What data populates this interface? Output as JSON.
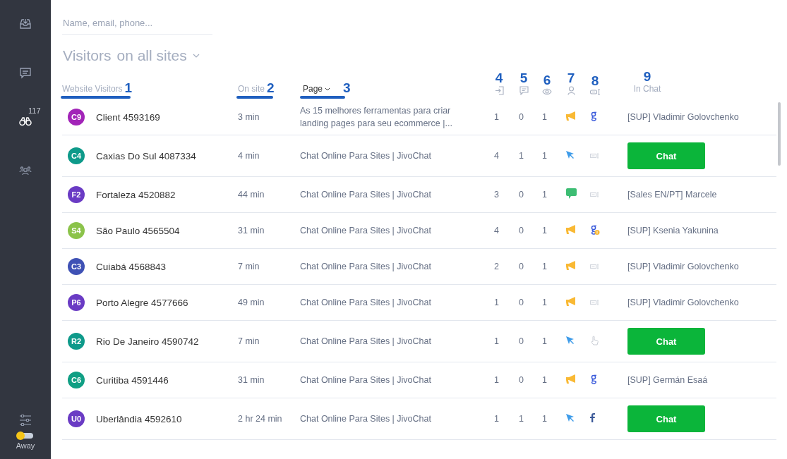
{
  "sidebar": {
    "items": [
      {
        "kind": "inbox",
        "selected": false
      },
      {
        "kind": "chats",
        "selected": false
      },
      {
        "kind": "visitors",
        "selected": true,
        "badge": "117"
      },
      {
        "kind": "team",
        "selected": false
      }
    ],
    "status": {
      "label": "Away",
      "online": false
    }
  },
  "search": {
    "placeholder": "Name, email, phone..."
  },
  "title": {
    "text": "Visitors",
    "filter": "on all sites"
  },
  "columns": [
    {
      "kind": "text",
      "label": "Website Visitors",
      "marker": "1"
    },
    {
      "kind": "text",
      "label": "On site",
      "marker": "2"
    },
    {
      "kind": "sort",
      "label": "Page",
      "marker": "3"
    },
    {
      "kind": "entries",
      "marker": "4"
    },
    {
      "kind": "messages",
      "marker": "5"
    },
    {
      "kind": "views",
      "marker": "6"
    },
    {
      "kind": "person",
      "marker": "7"
    },
    {
      "kind": "widget",
      "marker": "8"
    },
    {
      "kind": "text",
      "label": "In Chat",
      "marker": "9"
    }
  ],
  "rows": [
    {
      "initials": "C9",
      "color": "#a224b8",
      "name": "Client 4593169",
      "time": "3 min",
      "page": "As 15 melhores ferramentas para criar landing pages para seu ecommerce |...",
      "entries": "1",
      "messages": "0",
      "views": "1",
      "source": {
        "kind": "campaign"
      },
      "channel": {
        "kind": "google"
      },
      "agent": "[SUP] Vladimir Golovchenko"
    },
    {
      "initials": "C4",
      "color": "#0e9a8a",
      "name": "Caxias Do Sul 4087334",
      "time": "4 min",
      "page": "Chat Online Para Sites | JivoChat",
      "entries": "4",
      "messages": "1",
      "views": "1",
      "source": {
        "kind": "cursor"
      },
      "channel": {
        "kind": "widget"
      },
      "button": "Chat"
    },
    {
      "initials": "F2",
      "color": "#6a3bc4",
      "name": "Fortaleza 4520882",
      "time": "44 min",
      "page": "Chat Online Para Sites | JivoChat",
      "entries": "3",
      "messages": "0",
      "views": "1",
      "source": {
        "kind": "chat"
      },
      "channel": {
        "kind": "widget"
      },
      "agent": "[Sales EN/PT] Marcele"
    },
    {
      "initials": "S4",
      "color": "#8bc34a",
      "name": "São Paulo 4565504",
      "time": "31 min",
      "page": "Chat Online Para Sites | JivoChat",
      "entries": "4",
      "messages": "0",
      "views": "1",
      "source": {
        "kind": "campaign"
      },
      "channel": {
        "kind": "google-paid"
      },
      "agent": "[SUP] Ksenia Yakunina"
    },
    {
      "initials": "C3",
      "color": "#3f51b5",
      "name": "Cuiabá 4568843",
      "time": "7 min",
      "page": "Chat Online Para Sites | JivoChat",
      "entries": "2",
      "messages": "0",
      "views": "1",
      "source": {
        "kind": "campaign"
      },
      "channel": {
        "kind": "widget"
      },
      "agent": "[SUP] Vladimir Golovchenko"
    },
    {
      "initials": "P6",
      "color": "#6a3bc4",
      "name": "Porto Alegre 4577666",
      "time": "49 min",
      "page": "Chat Online Para Sites | JivoChat",
      "entries": "1",
      "messages": "0",
      "views": "1",
      "source": {
        "kind": "campaign"
      },
      "channel": {
        "kind": "widget"
      },
      "agent": "[SUP] Vladimir Golovchenko"
    },
    {
      "initials": "R2",
      "color": "#0e9a8a",
      "name": "Rio De Janeiro 4590742",
      "time": "7 min",
      "page": "Chat Online Para Sites | JivoChat",
      "entries": "1",
      "messages": "0",
      "views": "1",
      "source": {
        "kind": "cursor"
      },
      "channel": {
        "kind": "hand"
      },
      "button": "Chat"
    },
    {
      "initials": "C6",
      "color": "#109f84",
      "name": "Curitiba 4591446",
      "time": "31 min",
      "page": "Chat Online Para Sites | JivoChat",
      "entries": "1",
      "messages": "0",
      "views": "1",
      "source": {
        "kind": "campaign"
      },
      "channel": {
        "kind": "google"
      },
      "agent": "[SUP] Germán Esaá"
    },
    {
      "initials": "U0",
      "color": "#6a3bc4",
      "name": "Uberlândia 4592610",
      "time": "2 hr 24 min",
      "page": "Chat Online Para Sites | JivoChat",
      "entries": "1",
      "messages": "1",
      "views": "1",
      "source": {
        "kind": "cursor"
      },
      "channel": {
        "kind": "facebook"
      },
      "button": "Chat"
    }
  ]
}
